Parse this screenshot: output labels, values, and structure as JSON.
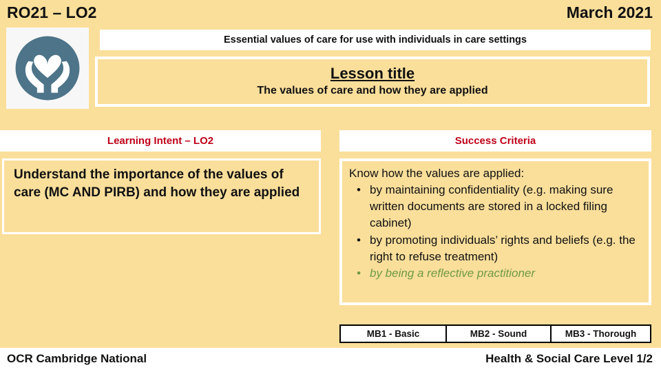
{
  "header": {
    "unit_code": "RO21 – LO2",
    "date": "March 2021"
  },
  "logo": {
    "icon": "heart-in-hands-icon",
    "circle_color": "#4d7489",
    "symbol_color": "#ffffff",
    "plate_color": "#f7f7f7"
  },
  "banner": {
    "text": "Essential values of care for use with individuals in care settings"
  },
  "lesson": {
    "title": "Lesson title",
    "subtitle": "The values of care and how they are applied"
  },
  "columns": {
    "learning_intent": {
      "heading": "Learning Intent – LO2",
      "heading_color": "#c00018",
      "body": "Understand the importance of the values of care (MC AND PIRB) and how they are applied"
    },
    "success_criteria": {
      "heading": "Success Criteria",
      "heading_color": "#c00018",
      "lead": "Know how the values are applied:",
      "bullets": [
        {
          "text": "by maintaining confidentiality (e.g. making sure written documents are stored in a locked filing cabinet)",
          "style": "normal"
        },
        {
          "text": "by promoting individuals’ rights and beliefs (e.g. the right to refuse treatment)",
          "style": "normal"
        },
        {
          "text": "by being a reflective practitioner",
          "style": "green-italic"
        }
      ],
      "bullet_glyph": "•",
      "green_color": "#6f9a45"
    }
  },
  "mark_bands": [
    {
      "label": "MB1 - Basic"
    },
    {
      "label": "MB2 - Sound"
    },
    {
      "label": "MB3 - Thorough"
    }
  ],
  "footer": {
    "left": "OCR Cambridge National",
    "right": "Health & Social Care Level 1/2"
  },
  "theme": {
    "background": "#fadf9b",
    "panel_border": "#ffffff",
    "text": "#111111"
  }
}
